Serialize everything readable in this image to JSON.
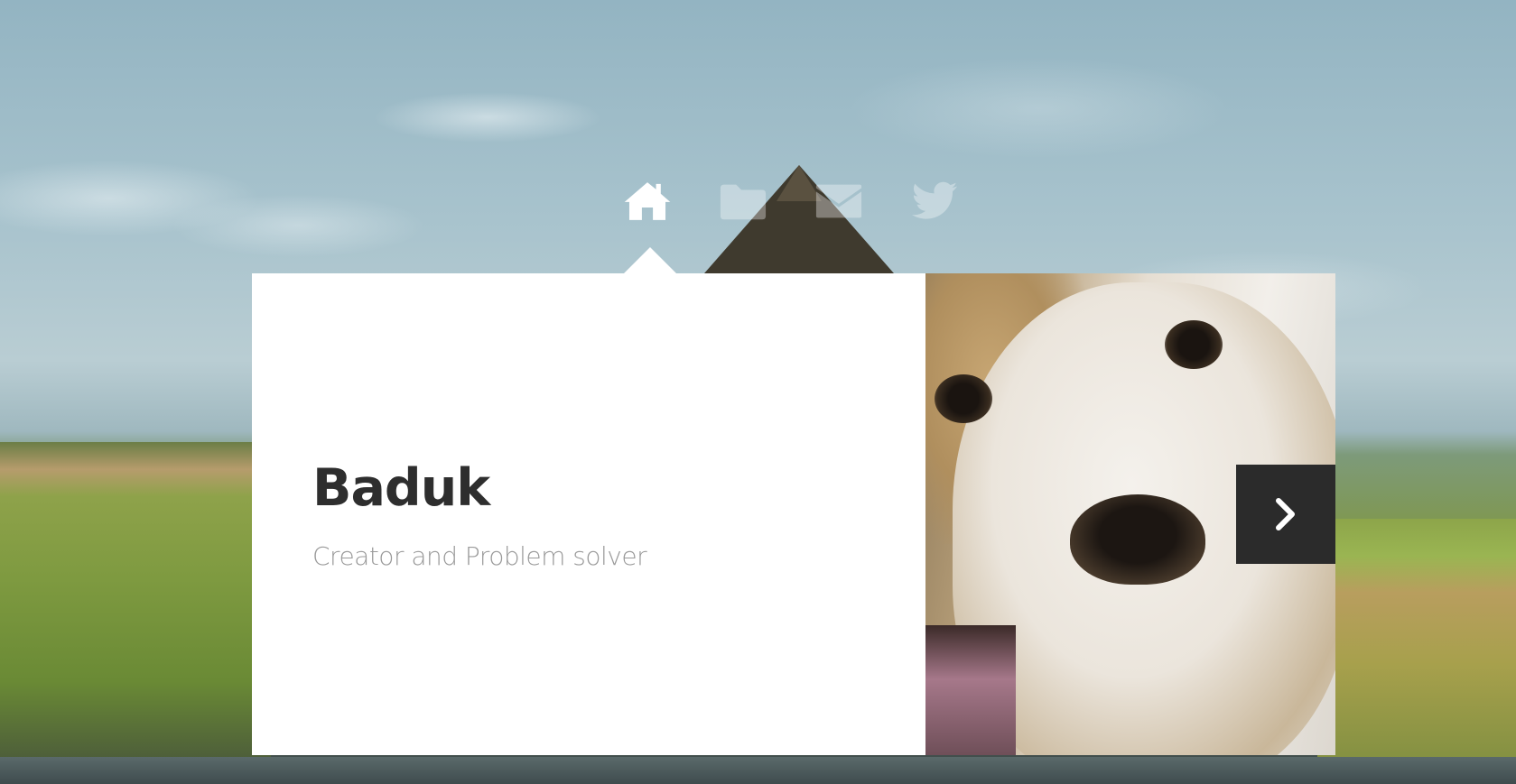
{
  "nav": {
    "items": [
      {
        "icon": "home-icon",
        "active": true
      },
      {
        "icon": "folder-icon",
        "active": false
      },
      {
        "icon": "mail-icon",
        "active": false
      },
      {
        "icon": "twitter-icon",
        "active": false
      }
    ]
  },
  "profile": {
    "name": "Baduk",
    "tagline": "Creator and Problem solver"
  },
  "slider": {
    "next_icon": "chevron-right-icon"
  },
  "colors": {
    "card_background": "#ffffff",
    "name_color": "#2e2e2e",
    "tagline_color": "#9a9a9a",
    "next_button_background": "#2b2b2b"
  }
}
